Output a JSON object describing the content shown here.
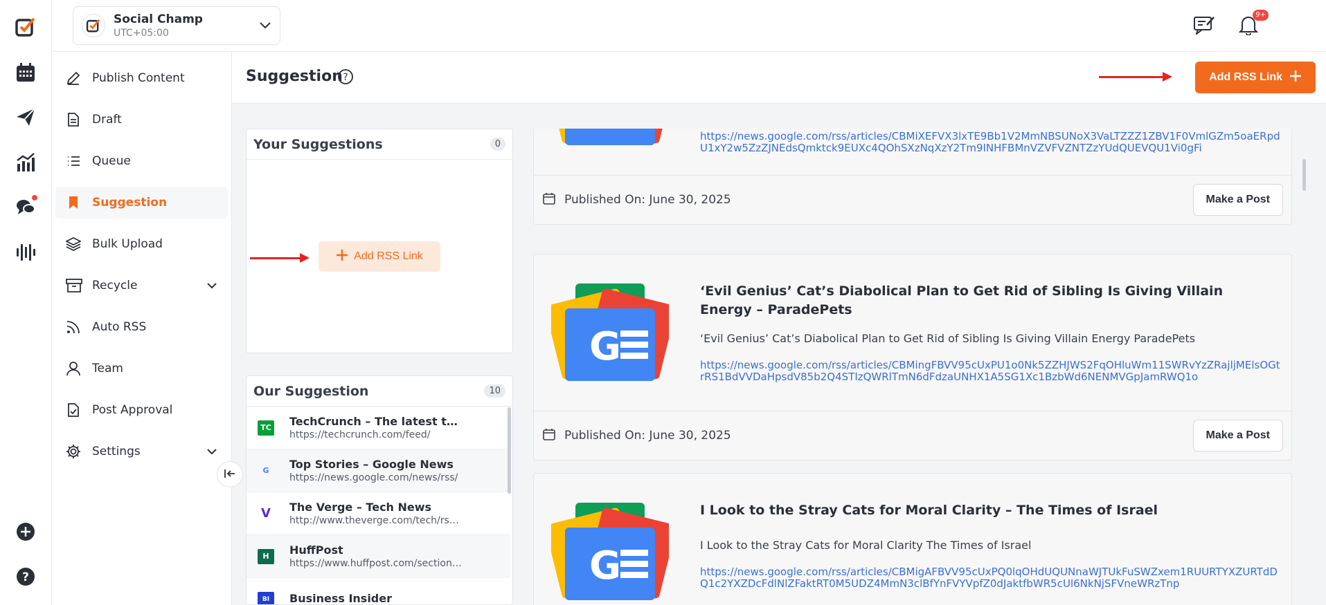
{
  "account": {
    "name": "Social Champ",
    "timezone": "UTC+05:00"
  },
  "notifications": {
    "badge": "9+"
  },
  "sidebar": {
    "items": [
      {
        "label": "Publish Content"
      },
      {
        "label": "Draft"
      },
      {
        "label": "Queue"
      },
      {
        "label": "Suggestion"
      },
      {
        "label": "Bulk Upload"
      },
      {
        "label": "Recycle"
      },
      {
        "label": "Auto RSS"
      },
      {
        "label": "Team"
      },
      {
        "label": "Post Approval"
      },
      {
        "label": "Settings"
      }
    ]
  },
  "header": {
    "title": "Suggestion",
    "add_rss_label": "Add RSS Link"
  },
  "your_suggestions": {
    "title": "Your Suggestions",
    "count": "0",
    "add_rss_label": "Add RSS Link"
  },
  "our_suggestion": {
    "title": "Our Suggestion",
    "count": "10",
    "feeds": [
      {
        "title": "TechCrunch – The latest technology news",
        "url": "https://techcrunch.com/feed/",
        "icon": "TC"
      },
      {
        "title": "Top Stories – Google News",
        "url": "https://news.google.com/news/rss/",
        "icon": "G"
      },
      {
        "title": "The Verge – Tech News",
        "url": "http://www.theverge.com/tech/rss/index.xml",
        "icon": "V"
      },
      {
        "title": "HuffPost",
        "url": "https://www.huffpost.com/section/front-page/feed",
        "icon": "H"
      },
      {
        "title": "Business Insider",
        "url": "",
        "icon": "BI"
      }
    ]
  },
  "articles": [
    {
      "title": "",
      "description": "",
      "link": "https://news.google.com/rss/articles/CBMiXEFVX3lxTE9Bb1V2MmNBSUNoX3VaLTZZZ1ZBV1F0VmlGZm5oaERpdU1xY2w5ZzZJNEdsQmktck9EUXc4QOhSXzNqXzY2Tm9INHFBMnVZVFVZNTZzYUdQUEVQU1Vi0gFi",
      "published": "Published On: June 30, 2025",
      "action": "Make a Post"
    },
    {
      "title": "‘Evil Genius’ Cat’s Diabolical Plan to Get Rid of Sibling Is Giving Villain Energy – ParadePets",
      "description": "‘Evil Genius’ Cat’s Diabolical Plan to Get Rid of Sibling Is Giving Villain Energy ParadePets",
      "link": "https://news.google.com/rss/articles/CBMingFBVV95cUxPU1o0Nk5ZZHJWS2FqOHluWm11SWRvYzZRajljMElsOGtrRS1BdVVDaHpsdV85b2Q4STIzQWRlTmN6dFdzaUNHX1A5SG1Xc1BzbWd6NENMVGpJamRWQ1o",
      "published": "Published On: June 30, 2025",
      "action": "Make a Post"
    },
    {
      "title": "I Look to the Stray Cats for Moral Clarity – The Times of Israel",
      "description": "I Look to the Stray Cats for Moral Clarity The Times of Israel",
      "link": "https://news.google.com/rss/articles/CBMigAFBVV95cUxPQ0lqOHdUQUNnaWJTUkFuSWZxem1RUURTYXZURTdDQ1c2YXZDcFdlNlZFaktRT0M5UDZ4MmN3clBfYnFVYVpfZ0dJaktfbWR5cUl6NkNjSFVneWRzTnp",
      "published": "",
      "action": ""
    }
  ],
  "colors": {
    "accent": "#f26b1d",
    "link": "#3b6fd2",
    "arrow": "#e5231f"
  }
}
